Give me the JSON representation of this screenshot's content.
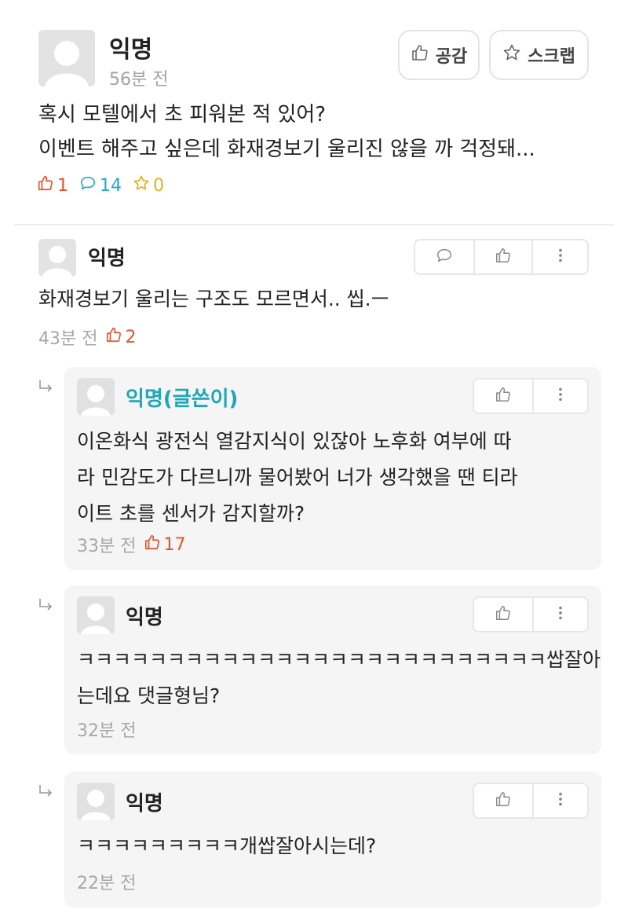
{
  "post": {
    "author": "익명",
    "time": "56분 전",
    "empathize_label": "공감",
    "scrap_label": "스크랩",
    "body_lines": [
      "혹시 모텔에서 초 피워본 적 있어?",
      "이벤트 해주고 싶은데 화재경보기 울리진 않을 까 걱정돼..."
    ],
    "like_count": "1",
    "comment_count": "14",
    "scrap_count": "0"
  },
  "comments": [
    {
      "author": "익명",
      "body_lines": [
        "화재경보기 울리는 구조도 모르면서.. 씹.ㅡ"
      ],
      "time": "43분 전",
      "like_count": "2"
    }
  ],
  "replies": [
    {
      "author": "익명(글쓴이)",
      "body_lines": [
        "이온화식 광전식 열감지식이 있잖아 노후화 여부에 따",
        "라 민감도가 다르니까 물어봤어 너가 생각했을 땐 티라",
        "이트 초를 센서가 감지할까?"
      ],
      "time": "33분 전",
      "like_count": "17"
    },
    {
      "author": "익명",
      "body_lines": [
        "ㅋㅋㅋㅋㅋㅋㅋㅋㅋㅋㅋㅋㅋㅋㅋㅋㅋㅋㅋㅋㅋㅋㅋㅋㅋㅋ쌉잘아",
        "는데요 댓글형님?"
      ],
      "time": "32분 전"
    },
    {
      "author": "익명",
      "body_lines": [
        "ㅋㅋㅋㅋㅋㅋㅋㅋㅋ개쌉잘아시는데?"
      ],
      "time": "22분 전"
    }
  ],
  "colors": {
    "like": "#e5532a",
    "comment": "#2aa7c7",
    "scrap": "#e4b11d",
    "op_author": "#1fa6b8"
  },
  "icons": [
    "avatar-placeholder",
    "thumbs-up-icon",
    "star-icon",
    "speech-bubble-icon",
    "more-vertical-icon",
    "reply-arrow-icon"
  ]
}
